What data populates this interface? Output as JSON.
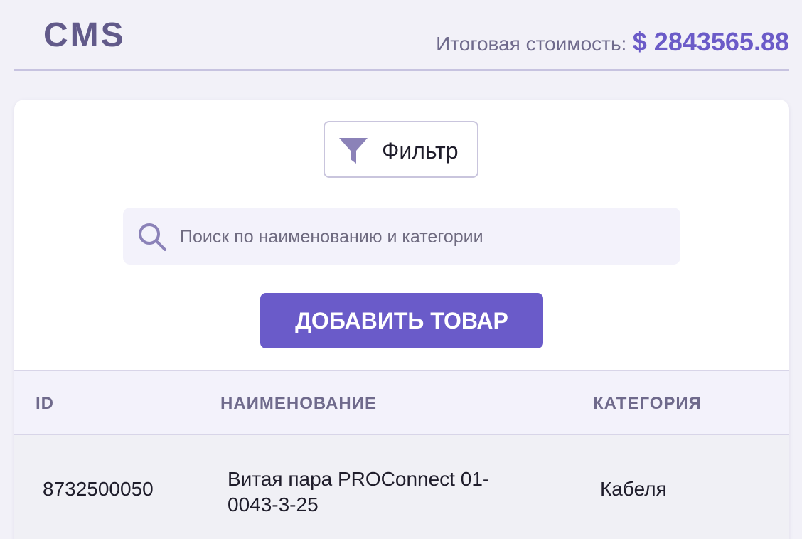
{
  "header": {
    "logo": "CMS",
    "total_label": "Итоговая стоимость:",
    "total_value": "$ 2843565.88"
  },
  "toolbar": {
    "filter_label": "Фильтр",
    "filter_icon": "funnel-icon",
    "search_icon": "search-icon",
    "search_placeholder": "Поиск по наименованию и категории",
    "search_value": "",
    "add_label": "ДОБАВИТЬ ТОВАР"
  },
  "table": {
    "columns": [
      "ID",
      "НАИМЕНОВАНИЕ",
      "КАТЕГОРИЯ"
    ],
    "rows": [
      {
        "id": "8732500050",
        "name": "Витая пара PROConnect 01-0043-3-25",
        "category": "Кабеля"
      }
    ]
  },
  "colors": {
    "accent": "#6a5bc9",
    "logo": "#625a8a",
    "background": "#f2f1f8",
    "muted_text": "#6f6a8c"
  }
}
